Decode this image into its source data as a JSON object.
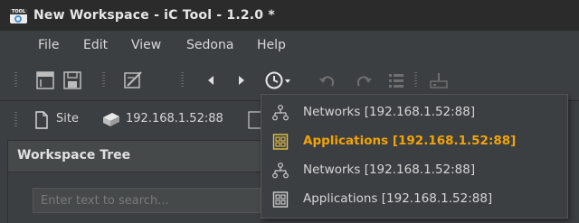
{
  "window": {
    "title": "New Workspace - iC Tool - 1.2.0 *",
    "icon_text": "TOOL"
  },
  "menu": {
    "items": [
      "File",
      "Edit",
      "View",
      "Sedona",
      "Help"
    ]
  },
  "location": {
    "site_label": "Site",
    "address": "192.168.1.52:88"
  },
  "panel": {
    "title": "Workspace Tree",
    "search_placeholder": "Enter text to search..."
  },
  "history_dropdown": {
    "items": [
      {
        "icon": "network-icon",
        "label": "Networks [192.168.1.52:88]",
        "active": false
      },
      {
        "icon": "applications-icon",
        "label": "Applications [192.168.1.52:88]",
        "active": true
      },
      {
        "icon": "network-icon",
        "label": "Networks [192.168.1.52:88]",
        "active": false
      },
      {
        "icon": "applications-icon",
        "label": "Applications [192.168.1.52:88]",
        "active": false
      }
    ]
  },
  "colors": {
    "accent": "#f0a30a",
    "background": "#3c3f41",
    "titlebar": "#2b2b2b"
  }
}
